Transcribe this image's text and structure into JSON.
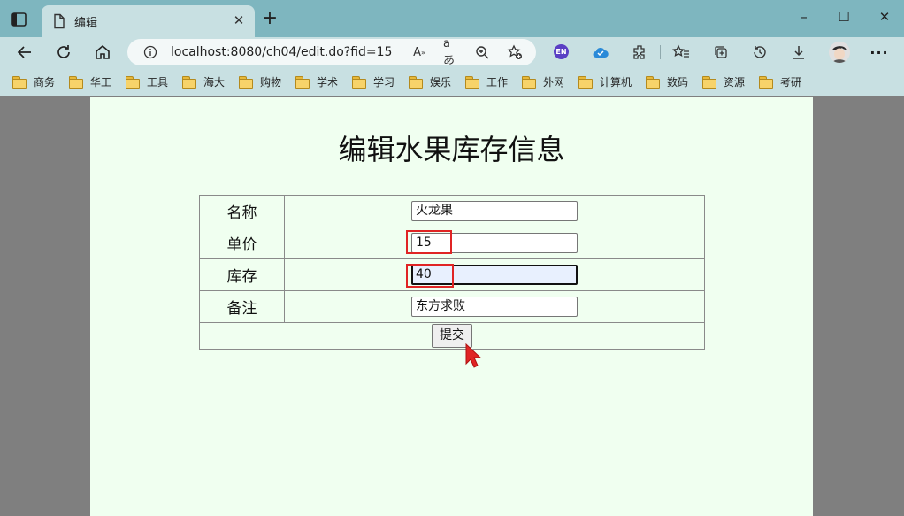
{
  "browser": {
    "tab": {
      "title": "编辑"
    },
    "address": {
      "url": "localhost:8080/ch04/edit.do?fid=15"
    },
    "extensions": {
      "en_badge": "EN"
    },
    "bookmarks": [
      "商务",
      "华工",
      "工具",
      "海大",
      "购物",
      "学术",
      "学习",
      "娱乐",
      "工作",
      "外网",
      "计算机",
      "数码",
      "资源",
      "考研"
    ]
  },
  "page": {
    "title": "编辑水果库存信息",
    "rows": [
      {
        "label": "名称",
        "value": "火龙果"
      },
      {
        "label": "单价",
        "value": "15"
      },
      {
        "label": "库存",
        "value": "40"
      },
      {
        "label": "备注",
        "value": "东方求败"
      }
    ],
    "submit_label": "提交"
  },
  "colors": {
    "page_background": "#f0fff0",
    "highlight_box": "#e02424",
    "cursor": "#e02424"
  }
}
